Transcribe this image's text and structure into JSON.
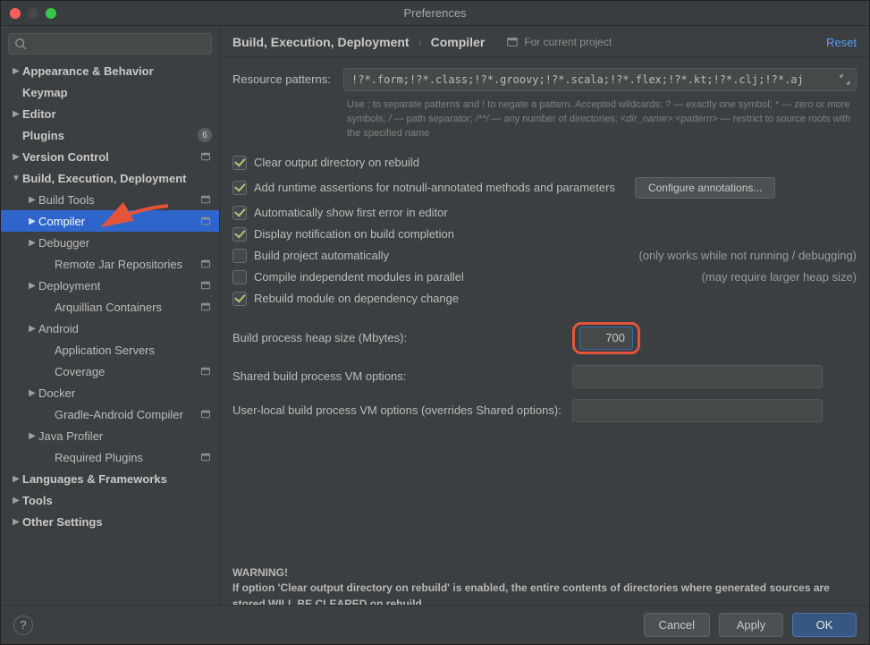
{
  "window": {
    "title": "Preferences"
  },
  "sidebar": {
    "search_placeholder": "",
    "items": [
      {
        "label": "Appearance & Behavior",
        "bold": true,
        "arrow": "▶",
        "indent": 0
      },
      {
        "label": "Keymap",
        "bold": true,
        "arrow": "",
        "indent": 0
      },
      {
        "label": "Editor",
        "bold": true,
        "arrow": "▶",
        "indent": 0
      },
      {
        "label": "Plugins",
        "bold": true,
        "arrow": "",
        "indent": 0,
        "badge": "6"
      },
      {
        "label": "Version Control",
        "bold": true,
        "arrow": "▶",
        "indent": 0,
        "proj": true
      },
      {
        "label": "Build, Execution, Deployment",
        "bold": true,
        "arrow": "▼",
        "indent": 0
      },
      {
        "label": "Build Tools",
        "bold": false,
        "arrow": "▶",
        "indent": 1,
        "proj": true
      },
      {
        "label": "Compiler",
        "bold": false,
        "arrow": "▶",
        "indent": 1,
        "proj": true,
        "selected": true
      },
      {
        "label": "Debugger",
        "bold": false,
        "arrow": "▶",
        "indent": 1
      },
      {
        "label": "Remote Jar Repositories",
        "bold": false,
        "arrow": "",
        "indent": 2,
        "proj": true
      },
      {
        "label": "Deployment",
        "bold": false,
        "arrow": "▶",
        "indent": 1,
        "proj": true
      },
      {
        "label": "Arquillian Containers",
        "bold": false,
        "arrow": "",
        "indent": 2,
        "proj": true
      },
      {
        "label": "Android",
        "bold": false,
        "arrow": "▶",
        "indent": 1
      },
      {
        "label": "Application Servers",
        "bold": false,
        "arrow": "",
        "indent": 2
      },
      {
        "label": "Coverage",
        "bold": false,
        "arrow": "",
        "indent": 2,
        "proj": true
      },
      {
        "label": "Docker",
        "bold": false,
        "arrow": "▶",
        "indent": 1
      },
      {
        "label": "Gradle-Android Compiler",
        "bold": false,
        "arrow": "",
        "indent": 2,
        "proj": true
      },
      {
        "label": "Java Profiler",
        "bold": false,
        "arrow": "▶",
        "indent": 1
      },
      {
        "label": "Required Plugins",
        "bold": false,
        "arrow": "",
        "indent": 2,
        "proj": true
      },
      {
        "label": "Languages & Frameworks",
        "bold": true,
        "arrow": "▶",
        "indent": 0
      },
      {
        "label": "Tools",
        "bold": true,
        "arrow": "▶",
        "indent": 0
      },
      {
        "label": "Other Settings",
        "bold": true,
        "arrow": "▶",
        "indent": 0
      }
    ]
  },
  "breadcrumb": {
    "a": "Build, Execution, Deployment",
    "b": "Compiler"
  },
  "for_project": "For current project",
  "reset": "Reset",
  "patterns": {
    "label": "Resource patterns:",
    "value": "!?*.form;!?*.class;!?*.groovy;!?*.scala;!?*.flex;!?*.kt;!?*.clj;!?*.aj",
    "hint_prefix": "Use ; to separate patterns and ! to negate a pattern. Accepted wildcards: ",
    "hint_q": "?",
    "hint_q_desc": " — exactly one symbol; ",
    "hint_star": "*",
    "hint_star_desc": " — zero or more symbols; ",
    "hint_slash": "/",
    "hint_slash_desc": " — path separator; ",
    "hint_dstar": "/**/",
    "hint_dstar_desc": " — any number of directories; ",
    "hint_dir": "<dir_name>:<pattern>",
    "hint_dir_desc": " — restrict to source roots with the specified name"
  },
  "checks": {
    "c1": "Clear output directory on rebuild",
    "c2": "Add runtime assertions for notnull-annotated methods and parameters",
    "c2_btn": "Configure annotations...",
    "c3": "Automatically show first error in editor",
    "c4": "Display notification on build completion",
    "c5": "Build project automatically",
    "c5_note": "(only works while not running / debugging)",
    "c6": "Compile independent modules in parallel",
    "c6_note": "(may require larger heap size)",
    "c7": "Rebuild module on dependency change"
  },
  "fields": {
    "heap_label": "Build process heap size (Mbytes):",
    "heap_value": "700",
    "shared_label": "Shared build process VM options:",
    "shared_value": "",
    "user_label": "User-local build process VM options (overrides Shared options):",
    "user_value": ""
  },
  "warning": {
    "title": "WARNING!",
    "body": "If option 'Clear output directory on rebuild' is enabled, the entire contents of directories where generated sources are stored WILL BE CLEARED on rebuild."
  },
  "footer": {
    "cancel": "Cancel",
    "apply": "Apply",
    "ok": "OK"
  }
}
